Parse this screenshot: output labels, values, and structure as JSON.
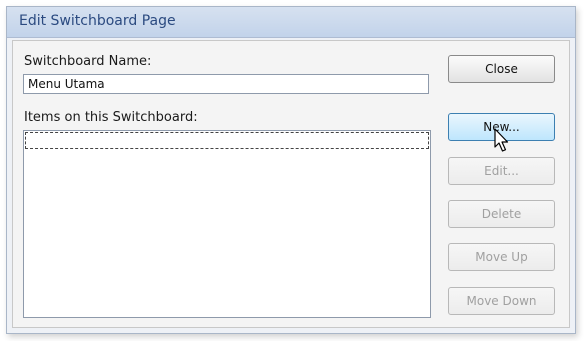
{
  "window": {
    "title": "Edit Switchboard Page"
  },
  "form": {
    "name_label": "Switchboard Name:",
    "name_value": "Menu Utama",
    "items_label": "Items on this Switchboard:",
    "items": []
  },
  "buttons": {
    "close": "Close",
    "new": "New...",
    "edit": "Edit...",
    "delete": "Delete",
    "move_up": "Move Up",
    "move_down": "Move Down"
  },
  "cursor": {
    "icon": "arrow-pointer-icon"
  }
}
